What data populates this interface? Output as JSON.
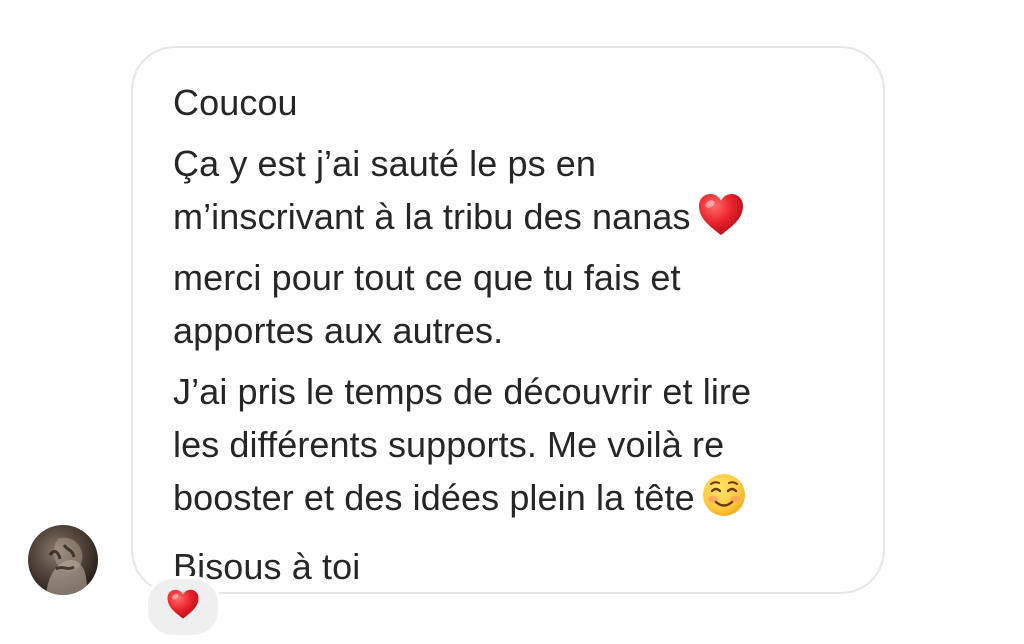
{
  "message": {
    "lines": [
      "Coucou",
      "Ça y est j’ai sauté le ps en",
      "m’inscrivant à la tribu des nanas",
      "merci pour tout ce que tu fais et",
      "apportes aux autres.",
      "J’ai pris le temps de découvrir et lire",
      "les différents supports. Me voilà re",
      "booster et des idées plein la tête",
      "Bisous à toi"
    ],
    "inline_emojis": [
      "red-heart-emoji",
      "smiling-face-emoji"
    ]
  },
  "reaction": {
    "emoji": "red-heart-emoji"
  },
  "colors": {
    "bubble_border": "#e6e6e6",
    "text": "#262626",
    "reaction_bg": "#efefef",
    "heart": "#e8202a"
  }
}
